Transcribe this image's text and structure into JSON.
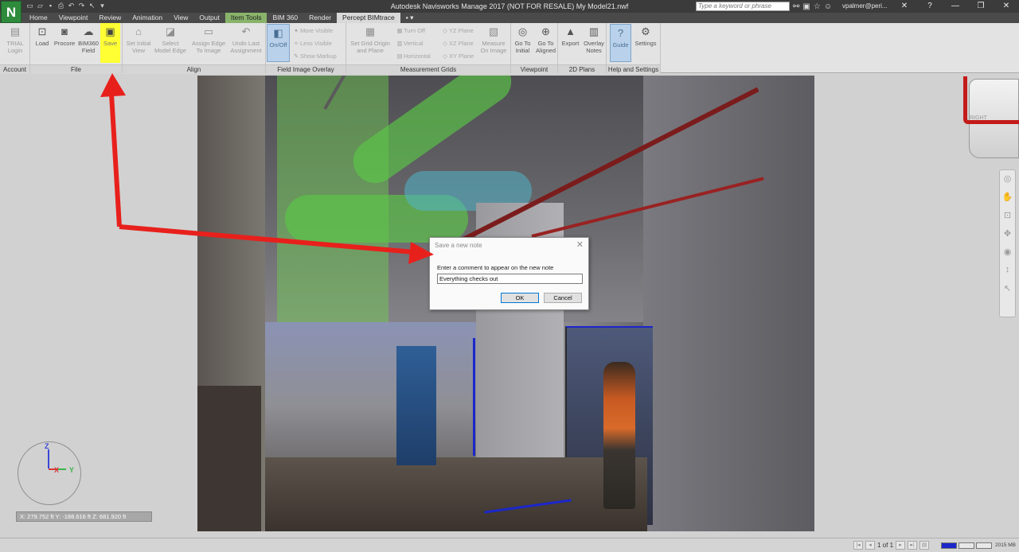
{
  "window": {
    "title": "Autodesk Navisworks Manage 2017 (NOT FOR RESALE)    My Model21.nwf",
    "app_logo": "N",
    "search_placeholder": "Type a keyword or phrase",
    "user": "vpalmer@peri...",
    "icons": [
      "binoculars-icon",
      "communication-center-icon",
      "favorites-star-icon",
      "user-icon",
      "exchange-icon",
      "help-icon"
    ]
  },
  "tabs": [
    {
      "label": "Home"
    },
    {
      "label": "Viewpoint"
    },
    {
      "label": "Review"
    },
    {
      "label": "Animation"
    },
    {
      "label": "View"
    },
    {
      "label": "Output"
    },
    {
      "label": "Item Tools"
    },
    {
      "label": "BIM 360"
    },
    {
      "label": "Render"
    },
    {
      "label": "Percept BIMtrace",
      "active": true
    }
  ],
  "ribbon": {
    "account": {
      "title": "Account",
      "login": "TRIAL\nLogin"
    },
    "file": {
      "title": "File",
      "load": "Load",
      "procore": "Procore",
      "bim360": "BIM360\nField",
      "save": "Save"
    },
    "align": {
      "title": "Align",
      "set_initial_view": "Set Initial\nView",
      "select_model_edge": "Select\nModel Edge",
      "assign_edge": "Assign Edge\nTo Image",
      "undo_last": "Undo Last\nAssignment"
    },
    "field_image_overlay": {
      "title": "Field Image Overlay",
      "onoff": "On/Off",
      "more_visible": "More Visible",
      "less_visible": "Less Visible",
      "show_markup": "Show Markup"
    },
    "measurement_grids": {
      "title": "Measurement Grids",
      "set_grid": "Set Grid Origin\nand Plane",
      "turn_off": "Turn Off",
      "vertical": "Vertical",
      "horizontal": "Horizontal",
      "yz_plane": "YZ Plane",
      "xz_plane": "XZ Plane",
      "xy_plane": "XY Plane",
      "measure": "Measure\nOn Image"
    },
    "viewpoint": {
      "title": "Viewpoint",
      "go_initial": "Go To\nInitial",
      "go_aligned": "Go To\nAligned"
    },
    "plans_2d": {
      "title": "2D Plans",
      "export": "Export",
      "overlay_notes": "Overlay\nNotes"
    },
    "help": {
      "title": "Help and Settings",
      "guide": "Guide",
      "settings": "Settings"
    }
  },
  "dialog": {
    "title": "Save a new note",
    "label": "Enter a comment to appear on the new note",
    "value": "Everything checks out",
    "ok": "OK",
    "cancel": "Cancel"
  },
  "viewcube": {
    "face_label": "RIGHT"
  },
  "compass": {
    "z": "Z",
    "x": "X",
    "y": "Y"
  },
  "coords": "X: 279.752 ft  Y: -188.616 ft  Z: 681.920 ft",
  "status": {
    "page": "1 of 1",
    "memory": "2015 MB"
  },
  "colors": {
    "annotation_arrow": "#e8201c",
    "highlight": "#ffff33",
    "item_tools_tab": "#89b36b"
  }
}
